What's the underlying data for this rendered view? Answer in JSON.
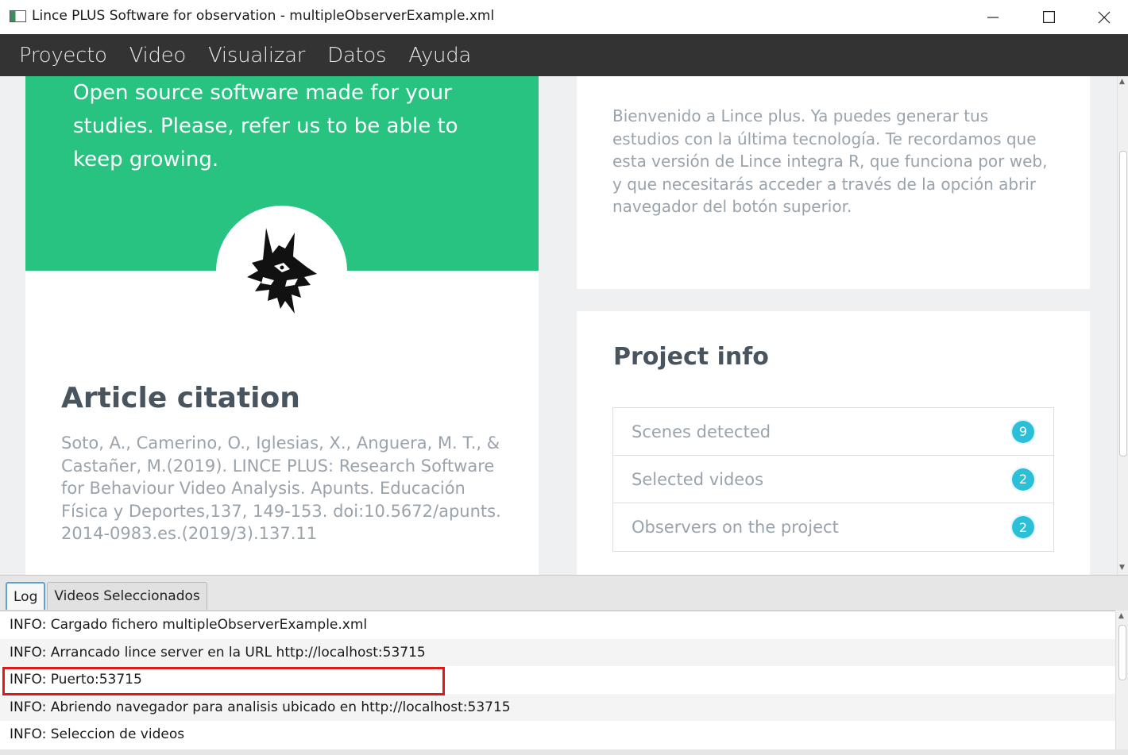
{
  "window": {
    "title": "Lince PLUS Software for observation - multipleObserverExample.xml"
  },
  "menu": {
    "items": [
      "Proyecto",
      "Video",
      "Visualizar",
      "Datos",
      "Ayuda"
    ]
  },
  "banner": {
    "text": "Open source software made for your studies. Please, refer us to be able to keep growing."
  },
  "article": {
    "title": "Article citation",
    "body": "Soto, A., Camerino, O., Iglesias, X., Anguera, M. T., & Castañer, M.(2019). LINCE PLUS: Research Software for Behaviour Video Analysis. Apunts. Educación Física y Deportes,137, 149-153. doi:10.5672/apunts. 2014-0983.es.(2019/3).137.11"
  },
  "welcome": {
    "text": "Bienvenido a Lince plus. Ya puedes generar tus estudios con la última tecnología. Te recordamos que esta versión de Lince integra R, que funciona por web, y que necesitarás acceder a través de la opción abrir navegador del botón superior."
  },
  "project_info": {
    "title": "Project info",
    "rows": [
      {
        "label": "Scenes detected",
        "count": "9"
      },
      {
        "label": "Selected videos",
        "count": "2"
      },
      {
        "label": "Observers on the project",
        "count": "2"
      }
    ]
  },
  "bottom": {
    "tabs": [
      "Log",
      "Videos Seleccionados"
    ],
    "active_tab": "Log",
    "log": [
      "INFO: Cargado fichero multipleObserverExample.xml",
      "INFO: Arrancado lince server en la URL http://localhost:53715",
      "INFO: Puerto:53715",
      "INFO: Abriendo navegador para analisis ubicado en http://localhost:53715",
      "INFO: Seleccion de videos"
    ]
  },
  "colors": {
    "accent_green": "#28c281",
    "badge": "#2bc0d8",
    "menubar": "#333333",
    "highlight": "#e01818"
  }
}
